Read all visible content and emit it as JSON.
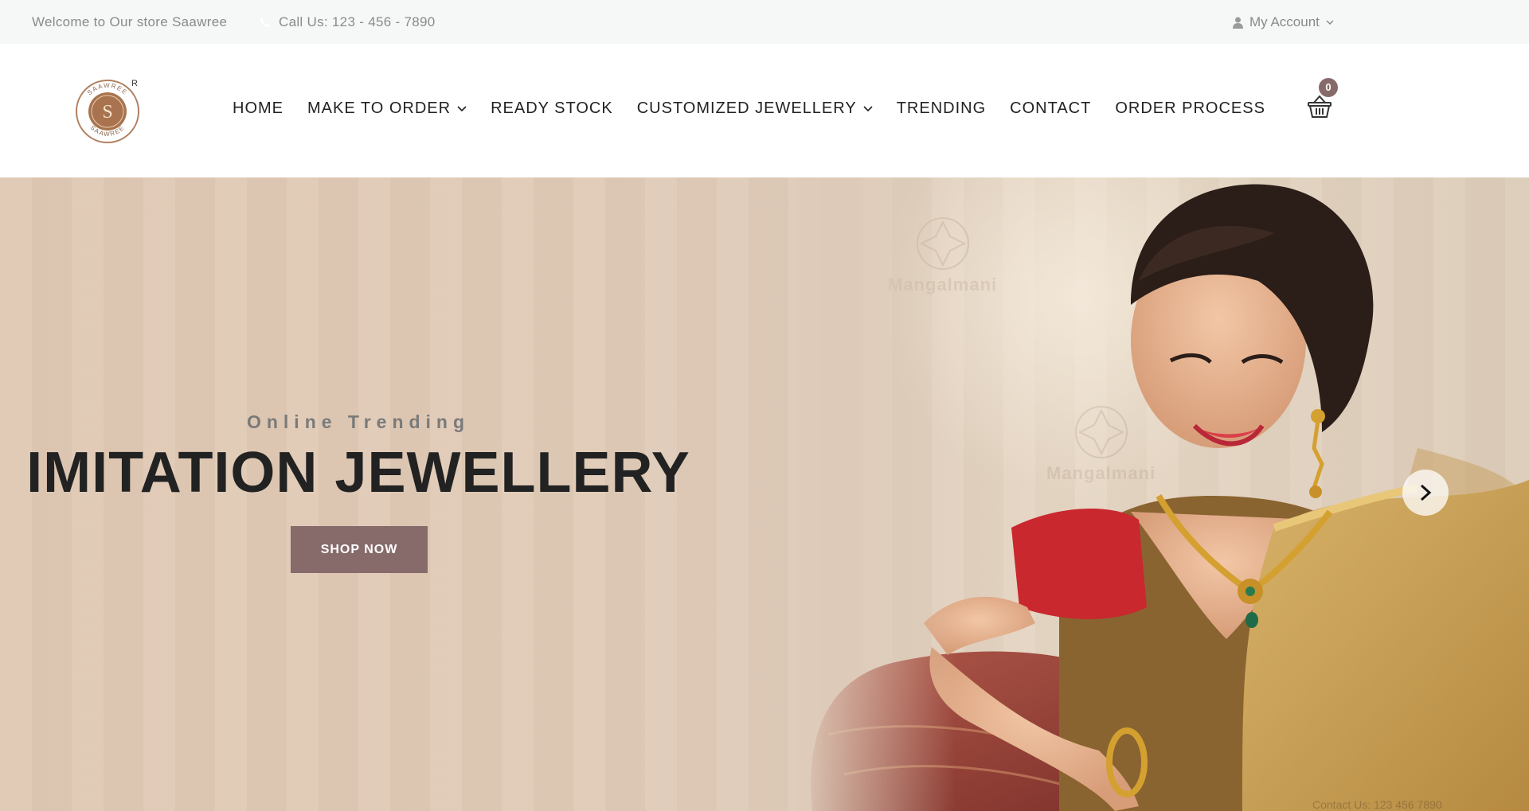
{
  "topbar": {
    "welcome": "Welcome to Our store Saawree",
    "phone": "Call Us: 123 - 456 - 7890",
    "account": "My Account"
  },
  "header": {
    "logo_text_top": "SAAWREE",
    "logo_text_bottom": "SAAWREE",
    "logo_letter": "S",
    "logo_registered": "R",
    "nav": [
      {
        "label": "HOME",
        "dropdown": false
      },
      {
        "label": "MAKE TO ORDER",
        "dropdown": true
      },
      {
        "label": "READY STOCK",
        "dropdown": false
      },
      {
        "label": "CUSTOMIZED JEWELLERY",
        "dropdown": true
      },
      {
        "label": "TRENDING",
        "dropdown": false
      },
      {
        "label": "CONTACT",
        "dropdown": false
      },
      {
        "label": "ORDER PROCESS",
        "dropdown": false
      }
    ],
    "cart_count": "0"
  },
  "hero": {
    "eyebrow": "Online Trending",
    "headline": "IMITATION JEWELLERY",
    "button": "SHOP NOW",
    "watermark_1": "Mangalmani",
    "watermark_2": "Mangalmani",
    "image_phone_line": "Contact Us: 123 456 7890"
  },
  "colors": {
    "accent": "#876a6a",
    "topbar_bg": "#f6f7f7",
    "hero_bg": "#dfc8b3",
    "text_dark": "#222222",
    "text_muted": "#8a8a8a"
  },
  "icons": [
    "phone-icon",
    "user-icon",
    "chevron-down-icon",
    "basket-icon",
    "chevron-right-icon",
    "logo-emblem"
  ]
}
